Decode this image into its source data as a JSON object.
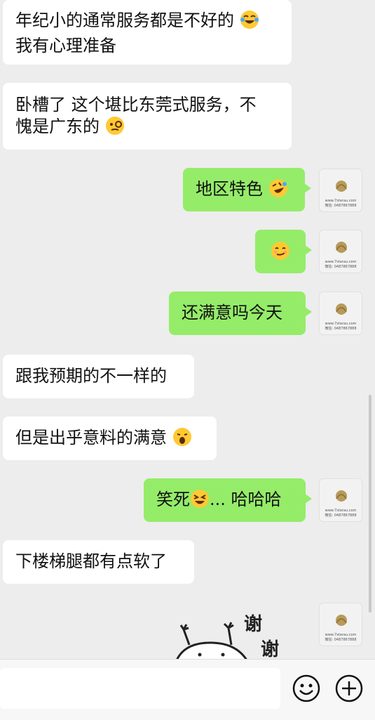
{
  "messages": [
    {
      "side": "in",
      "lines": [
        "年纪小的通常服务都是不好的",
        "我有心理准备"
      ],
      "emoji_after": "laughing-tears"
    },
    {
      "side": "in",
      "lines": [
        "卧槽了 这个堪比东莞式服务，不",
        "愧是广东的"
      ],
      "emoji_after": "monocle"
    },
    {
      "side": "out",
      "text": "地区特色",
      "emoji_after": "rolling-laugh"
    },
    {
      "side": "out",
      "text": "",
      "emoji_after": "smirk"
    },
    {
      "side": "out",
      "text": "还满意吗今天"
    },
    {
      "side": "in",
      "text": "跟我预期的不一样的"
    },
    {
      "side": "in",
      "text": "但是出乎意料的满意",
      "emoji_after": "surprised"
    },
    {
      "side": "out",
      "text_before": "笑死",
      "emoji": "grin-squint",
      "text_after": "... 哈哈哈"
    },
    {
      "side": "in",
      "text": "下楼梯腿都有点软了"
    }
  ],
  "avatar": {
    "line1": "www.7starau.com",
    "line2": "微信: 0487867888"
  },
  "sticker": {
    "chars": [
      "谢",
      "谢"
    ]
  },
  "input_bar": {
    "emoji_button_icon": "smiley-icon",
    "plus_button_icon": "plus-circle-icon"
  },
  "colors": {
    "outgoing": "#95ec69",
    "incoming": "#ffffff",
    "background": "#ededed"
  }
}
